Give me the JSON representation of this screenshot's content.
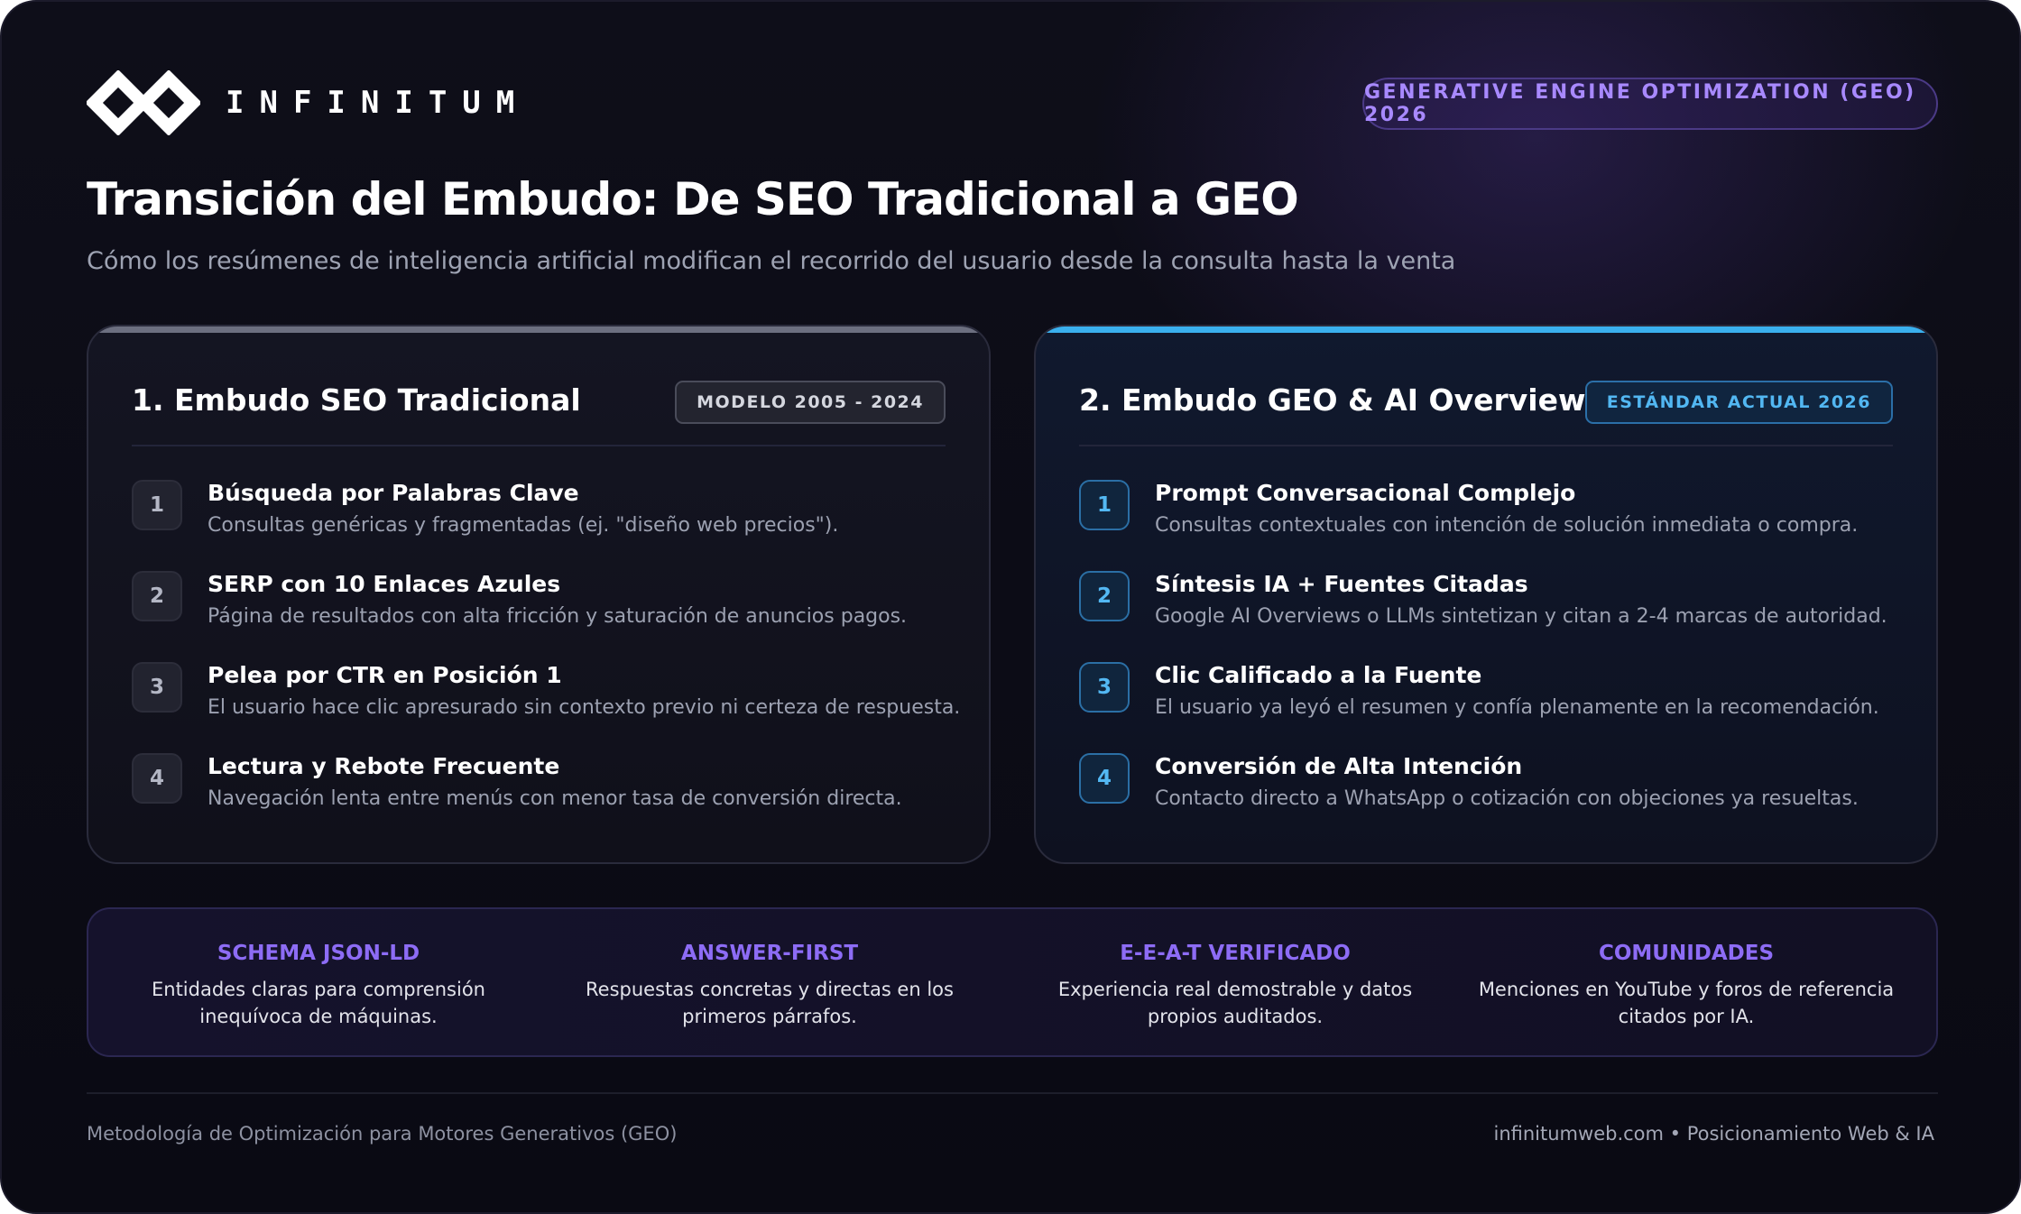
{
  "brand": {
    "name": "INFINITUM"
  },
  "header": {
    "badge": "GENERATIVE ENGINE OPTIMIZATION (GEO) 2026",
    "title": "Transición del Embudo: De SEO Tradicional a GEO",
    "subtitle": "Cómo los resúmenes de inteligencia artificial modifican el recorrido del usuario desde la consulta hasta la venta"
  },
  "cards": [
    {
      "title": "1. Embudo SEO Tradicional",
      "badge": "MODELO 2005 - 2024",
      "accent": "#6c6f80",
      "steps": [
        {
          "num": "1",
          "title": "Búsqueda por Palabras Clave",
          "desc": "Consultas genéricas y fragmentadas (ej. \"diseño web precios\")."
        },
        {
          "num": "2",
          "title": "SERP con 10 Enlaces Azules",
          "desc": "Página de resultados con alta fricción y saturación de anuncios pagos."
        },
        {
          "num": "3",
          "title": "Pelea por CTR en Posición 1",
          "desc": "El usuario hace clic apresurado sin contexto previo ni certeza de respuesta."
        },
        {
          "num": "4",
          "title": "Lectura y Rebote Frecuente",
          "desc": "Navegación lenta entre menús con menor tasa de conversión directa."
        }
      ]
    },
    {
      "title": "2. Embudo GEO & AI Overviews",
      "badge": "ESTÁNDAR ACTUAL 2026",
      "accent": "#3ab0ee",
      "steps": [
        {
          "num": "1",
          "title": "Prompt Conversacional Complejo",
          "desc": "Consultas contextuales con intención de solución inmediata o compra."
        },
        {
          "num": "2",
          "title": "Síntesis IA + Fuentes Citadas",
          "desc": "Google AI Overviews o LLMs sintetizan y citan a 2-4 marcas de autoridad."
        },
        {
          "num": "3",
          "title": "Clic Calificado a la Fuente",
          "desc": "El usuario ya leyó el resumen y confía plenamente en la recomendación."
        },
        {
          "num": "4",
          "title": "Conversión de Alta Intención",
          "desc": "Contacto directo a WhatsApp o cotización con objeciones ya resueltas."
        }
      ]
    }
  ],
  "pillars": [
    {
      "title": "SCHEMA JSON-LD",
      "desc": "Entidades claras para comprensión inequívoca de máquinas."
    },
    {
      "title": "ANSWER-FIRST",
      "desc": "Respuestas concretas y directas en los primeros párrafos."
    },
    {
      "title": "E-E-A-T VERIFICADO",
      "desc": "Experiencia real demostrable y datos propios auditados."
    },
    {
      "title": "COMUNIDADES",
      "desc": "Menciones en YouTube y foros de referencia citados por IA."
    }
  ],
  "footer": {
    "left": "Metodología de Optimización para Motores Generativos (GEO)",
    "right": "infinitumweb.com • Posicionamiento Web & IA"
  },
  "colors": {
    "background": "#0b0b14",
    "purple_accent": "#8d6cf5",
    "blue_accent": "#3ab0ee"
  }
}
